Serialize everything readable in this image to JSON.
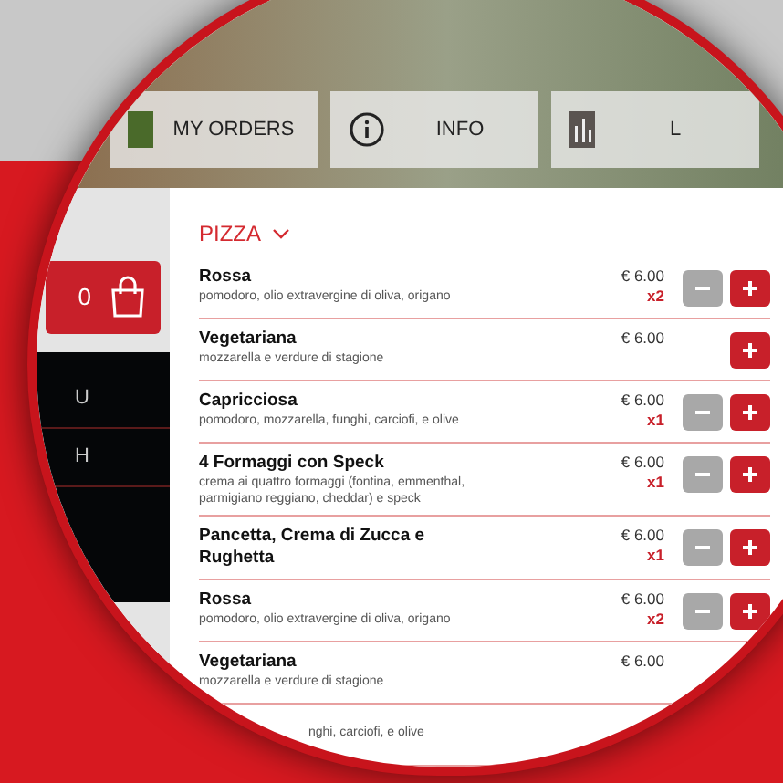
{
  "nav": [
    {
      "kind": "orders",
      "label": "MY ORDERS"
    },
    {
      "kind": "info",
      "label": "INFO"
    },
    {
      "kind": "other",
      "label": "L"
    }
  ],
  "cart": {
    "count": "0"
  },
  "sidebar": {
    "items": [
      "U",
      "H"
    ]
  },
  "category": {
    "title": "PIZZA",
    "expanded": true
  },
  "items": [
    {
      "name": "Rossa",
      "description": "pomodoro, olio extravergine di oliva, origano",
      "price": "€ 6.00",
      "quantity": "x2"
    },
    {
      "name": "Vegetariana",
      "description": "mozzarella e verdure di stagione",
      "price": "€ 6.00"
    },
    {
      "name": "Capricciosa",
      "description": "pomodoro, mozzarella, funghi, carciofi, e olive",
      "price": "€ 6.00",
      "quantity": "x1"
    },
    {
      "name": "4 Formaggi con Speck",
      "description": "crema ai quattro formaggi (fontina, emmenthal, parmigiano reggiano, cheddar) e speck",
      "price": "€ 6.00",
      "quantity": "x1"
    },
    {
      "name": "Pancetta, Crema di Zucca e Rughetta",
      "price": "€ 6.00",
      "quantity": "x1"
    },
    {
      "name": "Rossa",
      "description": "pomodoro, olio extravergine di oliva, origano",
      "price": "€ 6.00",
      "quantity": "x2"
    },
    {
      "name": "Vegetariana",
      "description": "mozzarella e verdure di stagione",
      "price": "€ 6.00",
      "controls_visible": false
    },
    {
      "description": "nghi, carciofi, e olive"
    }
  ]
}
